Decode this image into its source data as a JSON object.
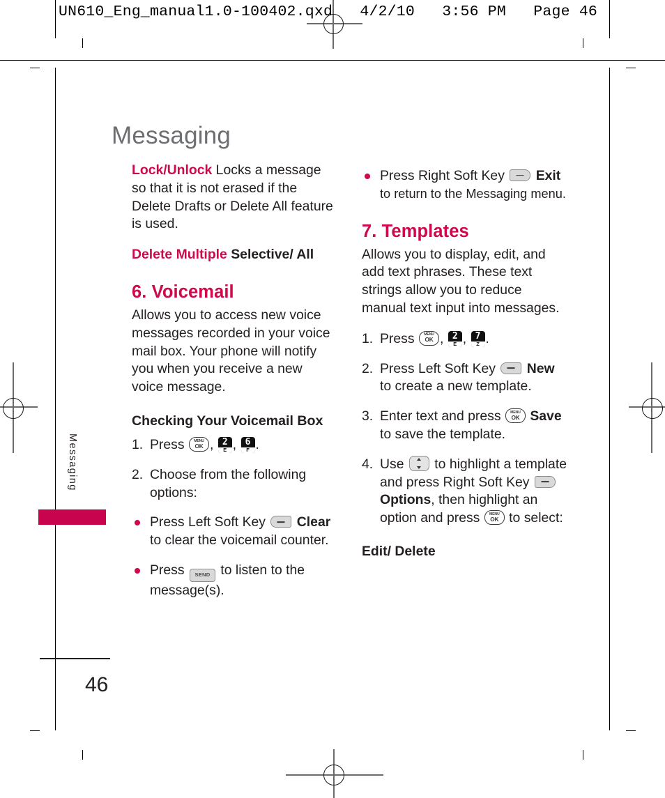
{
  "slug": {
    "text": "UN610_Eng_manual1.0-100402.qxd   4/2/10   3:56 PM   Page 46"
  },
  "page": {
    "title": "Messaging",
    "side_tab_label": "Messaging",
    "page_number": "46",
    "accent_color": "#cf0a4b",
    "tab_color": "#c8044f",
    "title_color": "#6d6e71"
  },
  "left_column": {
    "lock_unlock": {
      "keyword": "Lock/Unlock",
      "text": " Locks a message so that it is not erased if the Delete Drafts or Delete All feature is used."
    },
    "delete_multiple": {
      "keyword": "Delete Multiple",
      "value": "Selective/ All"
    },
    "voicemail": {
      "heading": "6. Voicemail",
      "intro": "Allows you to access new voice messages recorded in your voice mail box. Your phone will notify you when you receive a new voice message.",
      "subheading": "Checking Your Voicemail Box",
      "step1": {
        "num": "1.",
        "pre": "Press",
        "keys": [
          "menu-ok",
          "2-E",
          "6-F"
        ],
        "post": "."
      },
      "step2": {
        "num": "2.",
        "text": "Choose from the following options:"
      },
      "bullet1": {
        "pre": "Press Left Soft Key",
        "key": "left-soft",
        "label": "Clear",
        "post": "to clear the voicemail counter."
      },
      "bullet2": {
        "pre": "Press",
        "key": "send",
        "post": "to listen to the message(s)."
      }
    }
  },
  "right_column": {
    "bullet_exit": {
      "pre": "Press Right Soft Key",
      "key": "right-soft",
      "label": "Exit",
      "post": "to return to the Messaging menu."
    },
    "templates": {
      "heading": "7. Templates",
      "intro": "Allows you to display, edit, and add text phrases. These text strings allow you to reduce manual text input into messages.",
      "step1": {
        "num": "1.",
        "pre": "Press",
        "keys": [
          "menu-ok",
          "2-E",
          "7-Z"
        ],
        "post": "."
      },
      "step2": {
        "num": "2.",
        "pre": "Press Left Soft Key",
        "key": "left-soft",
        "label": "New",
        "post": "to create a new template."
      },
      "step3": {
        "num": "3.",
        "pre": "Enter text and press",
        "key": "menu-ok",
        "label": "Save",
        "post": "to save the template."
      },
      "step4": {
        "num": "4.",
        "seg1": "Use",
        "key_nav": "nav-updown",
        "seg2": "to highlight a template and press Right Soft",
        "seg3": "Key",
        "key_soft": "right-soft",
        "label": "Options",
        "seg4": ", then highlight an option and press",
        "key_ok": "menu-ok",
        "seg5": "to select:"
      },
      "options": "Edit/ Delete"
    }
  },
  "keys": {
    "menu_ok": {
      "line1": "MENU",
      "line2": "OK"
    },
    "num_2": {
      "digit": "2",
      "letter": "E"
    },
    "num_6": {
      "digit": "6",
      "letter": "F"
    },
    "num_7": {
      "digit": "7",
      "letter": "Z"
    },
    "send": {
      "label": "SEND"
    }
  }
}
